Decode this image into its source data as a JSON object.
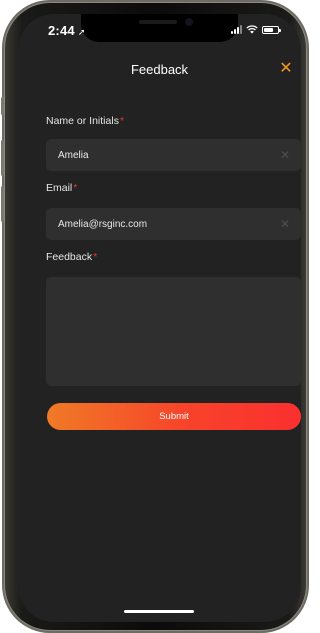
{
  "status_bar": {
    "time": "2:44",
    "location_glyph": "➚",
    "icons": [
      "signal-icon",
      "wifi-icon",
      "battery-icon"
    ]
  },
  "header": {
    "title": "Feedback",
    "close_glyph": "✕"
  },
  "form": {
    "name": {
      "label": "Name or Initials",
      "required_mark": "*",
      "value": "Amelia",
      "clear_glyph": "✕"
    },
    "email": {
      "label": "Email",
      "required_mark": "*",
      "value": "Amelia@rsginc.com",
      "clear_glyph": "✕"
    },
    "feedback": {
      "label": "Feedback",
      "required_mark": "*",
      "value": ""
    },
    "submit_label": "Submit"
  },
  "colors": {
    "background": "#222222",
    "field": "#2f2f2f",
    "accent": "#f39a1e",
    "required": "#e23a2f",
    "button_gradient_start": "#f07a26",
    "button_gradient_end": "#fb2f2f"
  }
}
